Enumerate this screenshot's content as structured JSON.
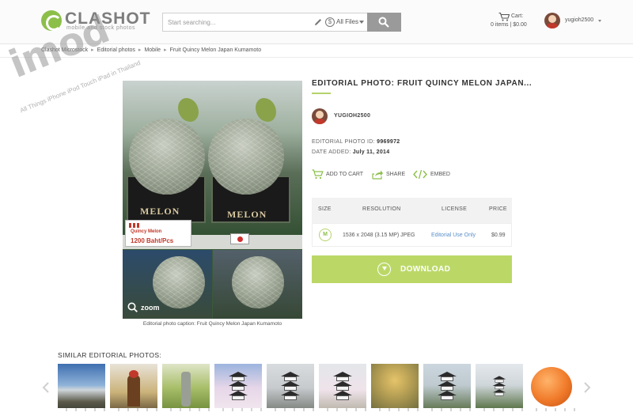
{
  "header": {
    "logo_name": "CLASHOT",
    "logo_tagline": "mobile and stock photos",
    "search_placeholder": "Start searching...",
    "files_filter": "All Files",
    "cart_label": "Cart:",
    "cart_info": "0 items  |  $0.00",
    "username": "yugioh2500"
  },
  "breadcrumb": [
    "Clashot Microstock",
    "Editorial photos",
    "Mobile",
    "Fruit Quincy Melon Japan Kumamoto"
  ],
  "watermark": {
    "word": "imod",
    "tagline": "All Things iPhone iPod Touch iPad in Thailand"
  },
  "photo": {
    "brand_text": "MELON",
    "price_tag_name": "Quincy Melon",
    "price_tag_price": "1200 Baht/Pcs",
    "zoom_label": "zoom",
    "caption": "Editorial photo caption: Fruit Quincy Melon Japan Kumamoto"
  },
  "details": {
    "title": "EDITORIAL PHOTO: FRUIT QUINCY MELON JAPAN...",
    "author": "YUGIOH2500",
    "photo_id_label": "EDITORIAL PHOTO ID:",
    "photo_id": "9969972",
    "date_label": "DATE ADDED:",
    "date": "July 11, 2014",
    "actions": {
      "add_to_cart": "ADD TO CART",
      "share": "SHARE",
      "embed": "EMBED"
    },
    "table": {
      "headers": [
        "SIZE",
        "RESOLUTION",
        "LICENSE",
        "PRICE"
      ],
      "row": {
        "size": "M",
        "resolution": "1536 x 2048 (3.15 MP) JPEG",
        "license": "Editorial Use Only",
        "price": "$0.99"
      }
    },
    "download_label": "DOWNLOAD"
  },
  "similar": {
    "title": "SIMILAR EDITORIAL PHOTOS:",
    "thumbnails": [
      "mountain",
      "samurai-statue",
      "garden-statue",
      "castle-blossom",
      "castle-dark",
      "castle-blossom-2",
      "tree-autumn",
      "castle-green",
      "castle-trees",
      "orange-melon"
    ]
  },
  "colors": {
    "accent": "#bbd867",
    "link": "#5a8fc7",
    "search_button": "#9a9a9a"
  }
}
